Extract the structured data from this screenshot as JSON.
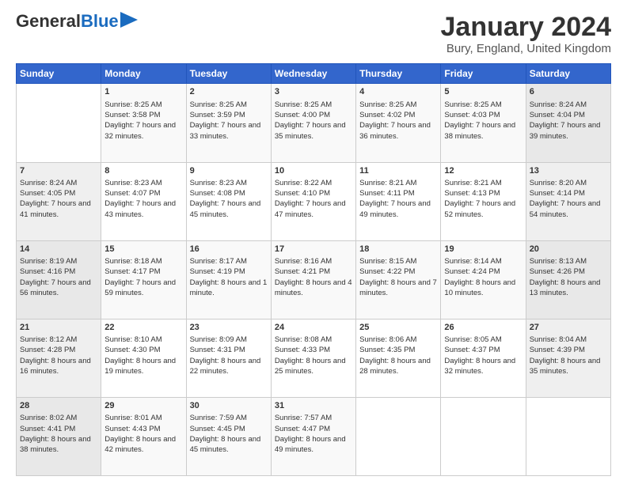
{
  "header": {
    "logo_general": "General",
    "logo_blue": "Blue",
    "month_title": "January 2024",
    "location": "Bury, England, United Kingdom"
  },
  "days_of_week": [
    "Sunday",
    "Monday",
    "Tuesday",
    "Wednesday",
    "Thursday",
    "Friday",
    "Saturday"
  ],
  "weeks": [
    [
      {
        "day": "",
        "sunrise": "",
        "sunset": "",
        "daylight": ""
      },
      {
        "day": "1",
        "sunrise": "Sunrise: 8:25 AM",
        "sunset": "Sunset: 3:58 PM",
        "daylight": "Daylight: 7 hours and 32 minutes."
      },
      {
        "day": "2",
        "sunrise": "Sunrise: 8:25 AM",
        "sunset": "Sunset: 3:59 PM",
        "daylight": "Daylight: 7 hours and 33 minutes."
      },
      {
        "day": "3",
        "sunrise": "Sunrise: 8:25 AM",
        "sunset": "Sunset: 4:00 PM",
        "daylight": "Daylight: 7 hours and 35 minutes."
      },
      {
        "day": "4",
        "sunrise": "Sunrise: 8:25 AM",
        "sunset": "Sunset: 4:02 PM",
        "daylight": "Daylight: 7 hours and 36 minutes."
      },
      {
        "day": "5",
        "sunrise": "Sunrise: 8:25 AM",
        "sunset": "Sunset: 4:03 PM",
        "daylight": "Daylight: 7 hours and 38 minutes."
      },
      {
        "day": "6",
        "sunrise": "Sunrise: 8:24 AM",
        "sunset": "Sunset: 4:04 PM",
        "daylight": "Daylight: 7 hours and 39 minutes."
      }
    ],
    [
      {
        "day": "7",
        "sunrise": "Sunrise: 8:24 AM",
        "sunset": "Sunset: 4:05 PM",
        "daylight": "Daylight: 7 hours and 41 minutes."
      },
      {
        "day": "8",
        "sunrise": "Sunrise: 8:23 AM",
        "sunset": "Sunset: 4:07 PM",
        "daylight": "Daylight: 7 hours and 43 minutes."
      },
      {
        "day": "9",
        "sunrise": "Sunrise: 8:23 AM",
        "sunset": "Sunset: 4:08 PM",
        "daylight": "Daylight: 7 hours and 45 minutes."
      },
      {
        "day": "10",
        "sunrise": "Sunrise: 8:22 AM",
        "sunset": "Sunset: 4:10 PM",
        "daylight": "Daylight: 7 hours and 47 minutes."
      },
      {
        "day": "11",
        "sunrise": "Sunrise: 8:21 AM",
        "sunset": "Sunset: 4:11 PM",
        "daylight": "Daylight: 7 hours and 49 minutes."
      },
      {
        "day": "12",
        "sunrise": "Sunrise: 8:21 AM",
        "sunset": "Sunset: 4:13 PM",
        "daylight": "Daylight: 7 hours and 52 minutes."
      },
      {
        "day": "13",
        "sunrise": "Sunrise: 8:20 AM",
        "sunset": "Sunset: 4:14 PM",
        "daylight": "Daylight: 7 hours and 54 minutes."
      }
    ],
    [
      {
        "day": "14",
        "sunrise": "Sunrise: 8:19 AM",
        "sunset": "Sunset: 4:16 PM",
        "daylight": "Daylight: 7 hours and 56 minutes."
      },
      {
        "day": "15",
        "sunrise": "Sunrise: 8:18 AM",
        "sunset": "Sunset: 4:17 PM",
        "daylight": "Daylight: 7 hours and 59 minutes."
      },
      {
        "day": "16",
        "sunrise": "Sunrise: 8:17 AM",
        "sunset": "Sunset: 4:19 PM",
        "daylight": "Daylight: 8 hours and 1 minute."
      },
      {
        "day": "17",
        "sunrise": "Sunrise: 8:16 AM",
        "sunset": "Sunset: 4:21 PM",
        "daylight": "Daylight: 8 hours and 4 minutes."
      },
      {
        "day": "18",
        "sunrise": "Sunrise: 8:15 AM",
        "sunset": "Sunset: 4:22 PM",
        "daylight": "Daylight: 8 hours and 7 minutes."
      },
      {
        "day": "19",
        "sunrise": "Sunrise: 8:14 AM",
        "sunset": "Sunset: 4:24 PM",
        "daylight": "Daylight: 8 hours and 10 minutes."
      },
      {
        "day": "20",
        "sunrise": "Sunrise: 8:13 AM",
        "sunset": "Sunset: 4:26 PM",
        "daylight": "Daylight: 8 hours and 13 minutes."
      }
    ],
    [
      {
        "day": "21",
        "sunrise": "Sunrise: 8:12 AM",
        "sunset": "Sunset: 4:28 PM",
        "daylight": "Daylight: 8 hours and 16 minutes."
      },
      {
        "day": "22",
        "sunrise": "Sunrise: 8:10 AM",
        "sunset": "Sunset: 4:30 PM",
        "daylight": "Daylight: 8 hours and 19 minutes."
      },
      {
        "day": "23",
        "sunrise": "Sunrise: 8:09 AM",
        "sunset": "Sunset: 4:31 PM",
        "daylight": "Daylight: 8 hours and 22 minutes."
      },
      {
        "day": "24",
        "sunrise": "Sunrise: 8:08 AM",
        "sunset": "Sunset: 4:33 PM",
        "daylight": "Daylight: 8 hours and 25 minutes."
      },
      {
        "day": "25",
        "sunrise": "Sunrise: 8:06 AM",
        "sunset": "Sunset: 4:35 PM",
        "daylight": "Daylight: 8 hours and 28 minutes."
      },
      {
        "day": "26",
        "sunrise": "Sunrise: 8:05 AM",
        "sunset": "Sunset: 4:37 PM",
        "daylight": "Daylight: 8 hours and 32 minutes."
      },
      {
        "day": "27",
        "sunrise": "Sunrise: 8:04 AM",
        "sunset": "Sunset: 4:39 PM",
        "daylight": "Daylight: 8 hours and 35 minutes."
      }
    ],
    [
      {
        "day": "28",
        "sunrise": "Sunrise: 8:02 AM",
        "sunset": "Sunset: 4:41 PM",
        "daylight": "Daylight: 8 hours and 38 minutes."
      },
      {
        "day": "29",
        "sunrise": "Sunrise: 8:01 AM",
        "sunset": "Sunset: 4:43 PM",
        "daylight": "Daylight: 8 hours and 42 minutes."
      },
      {
        "day": "30",
        "sunrise": "Sunrise: 7:59 AM",
        "sunset": "Sunset: 4:45 PM",
        "daylight": "Daylight: 8 hours and 45 minutes."
      },
      {
        "day": "31",
        "sunrise": "Sunrise: 7:57 AM",
        "sunset": "Sunset: 4:47 PM",
        "daylight": "Daylight: 8 hours and 49 minutes."
      },
      {
        "day": "",
        "sunrise": "",
        "sunset": "",
        "daylight": ""
      },
      {
        "day": "",
        "sunrise": "",
        "sunset": "",
        "daylight": ""
      },
      {
        "day": "",
        "sunrise": "",
        "sunset": "",
        "daylight": ""
      }
    ]
  ]
}
